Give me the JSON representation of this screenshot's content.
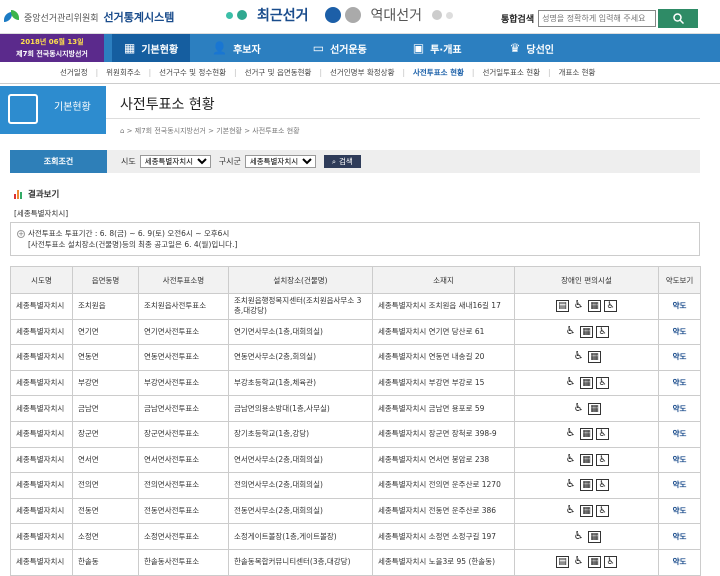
{
  "header": {
    "org": "중앙선거관리위원회",
    "system": "선거통계시스템",
    "recent": "최근선거",
    "past": "역대선거",
    "search_label": "통합검색",
    "search_placeholder": "성명을 정확하게 입력해 주세요"
  },
  "election": {
    "date": "2018년 06월 13일",
    "name": "제7회 전국동시지방선거"
  },
  "nav": [
    {
      "label": "기본현황",
      "icon": "▦"
    },
    {
      "label": "후보자",
      "icon": "👤"
    },
    {
      "label": "선거운동",
      "icon": "▭"
    },
    {
      "label": "투·개표",
      "icon": "▣"
    },
    {
      "label": "당선인",
      "icon": "♛"
    }
  ],
  "subnav": [
    "선거일정",
    "위원회주소",
    "선거구수 및 정수현황",
    "선거구 및 읍면동현황",
    "선거인명부 확정상황",
    "사전투표소 현황",
    "선거일투표소 현황",
    "개표소 현황"
  ],
  "side_title": "기본현황",
  "page_title": "사전투표소 현황",
  "breadcrumb": [
    "제7회 전국동시지방선거",
    "기본현황",
    "사전투표소 현황"
  ],
  "filter": {
    "label": "조회조건",
    "sido_label": "시도",
    "sido_value": "세종특별자치시",
    "gu_label": "구시군",
    "gu_value": "세종특별자치시",
    "button": "검색"
  },
  "result_title": "결과보기",
  "region_tag": "[세종특별자치시]",
  "notice": [
    "사전투표소 투표기간 : 6. 8(금) ~ 6. 9(토) 오전6시 ~ 오후6시",
    "[사전투표소 설치장소(건물명)등의 최종 공고일은 6. 4(월)입니다.]"
  ],
  "table": {
    "headers": [
      "시도명",
      "읍면동명",
      "사전투표소명",
      "설치장소(건물명)",
      "소재지",
      "장애인 편의시설",
      "약도보기"
    ],
    "rows": [
      [
        "세종특별자치시",
        "조치원읍",
        "조치원읍사전투표소",
        "조치원읍행정복지센터(조치원읍사무소 3층,대강당)",
        "세종특별자치시 조치원읍 새내16길 17",
        "4",
        "약도"
      ],
      [
        "세종특별자치시",
        "연기면",
        "연기면사전투표소",
        "연기면사무소(1층,대회의실)",
        "세종특별자치시 연기면 당산로 61",
        "3",
        "약도"
      ],
      [
        "세종특별자치시",
        "연동면",
        "연동면사전투표소",
        "연동면사무소(2층,회의실)",
        "세종특별자치시 연동면 내송길 20",
        "2",
        "약도"
      ],
      [
        "세종특별자치시",
        "부강면",
        "부강면사전투표소",
        "부강초등학교(1층,체육관)",
        "세종특별자치시 부강면 부강로 15",
        "3",
        "약도"
      ],
      [
        "세종특별자치시",
        "금남면",
        "금남면사전투표소",
        "금남면의용소방대(1층,사무실)",
        "세종특별자치시 금남면 용포로 59",
        "2",
        "약도"
      ],
      [
        "세종특별자치시",
        "장군면",
        "장군면사전투표소",
        "장기초등학교(1층,강당)",
        "세종특별자치시 장군면 장척로 398-9",
        "3",
        "약도"
      ],
      [
        "세종특별자치시",
        "연서면",
        "연서면사전투표소",
        "연서면사무소(2층,대회의실)",
        "세종특별자치시 연서면 봉암로 238",
        "3",
        "약도"
      ],
      [
        "세종특별자치시",
        "전의면",
        "전의면사전투표소",
        "전의면사무소(2층,대회의실)",
        "세종특별자치시 전의면 운주산로 1270",
        "3",
        "약도"
      ],
      [
        "세종특별자치시",
        "전동면",
        "전동면사전투표소",
        "전동면사무소(2층,대회의실)",
        "세종특별자치시 전동면 운주산로 386",
        "3",
        "약도"
      ],
      [
        "세종특별자치시",
        "소정면",
        "소정면사전투표소",
        "소정게이트볼장(1층,게이트볼장)",
        "세종특별자치시 소정면 소정구길 197",
        "2",
        "약도"
      ],
      [
        "세종특별자치시",
        "한솔동",
        "한솔동사전투표소",
        "한솔동복합커뮤니티센터(3층,대강당)",
        "세종특별자치시 노을3로 95 (한솔동)",
        "4",
        "약도"
      ]
    ]
  },
  "colors": {
    "nav": "#2c7fc0",
    "nav_active": "#155ea0",
    "election_bg": "#5b2a8c",
    "side": "#2d8ccf",
    "search_btn": "#2e8b66"
  }
}
